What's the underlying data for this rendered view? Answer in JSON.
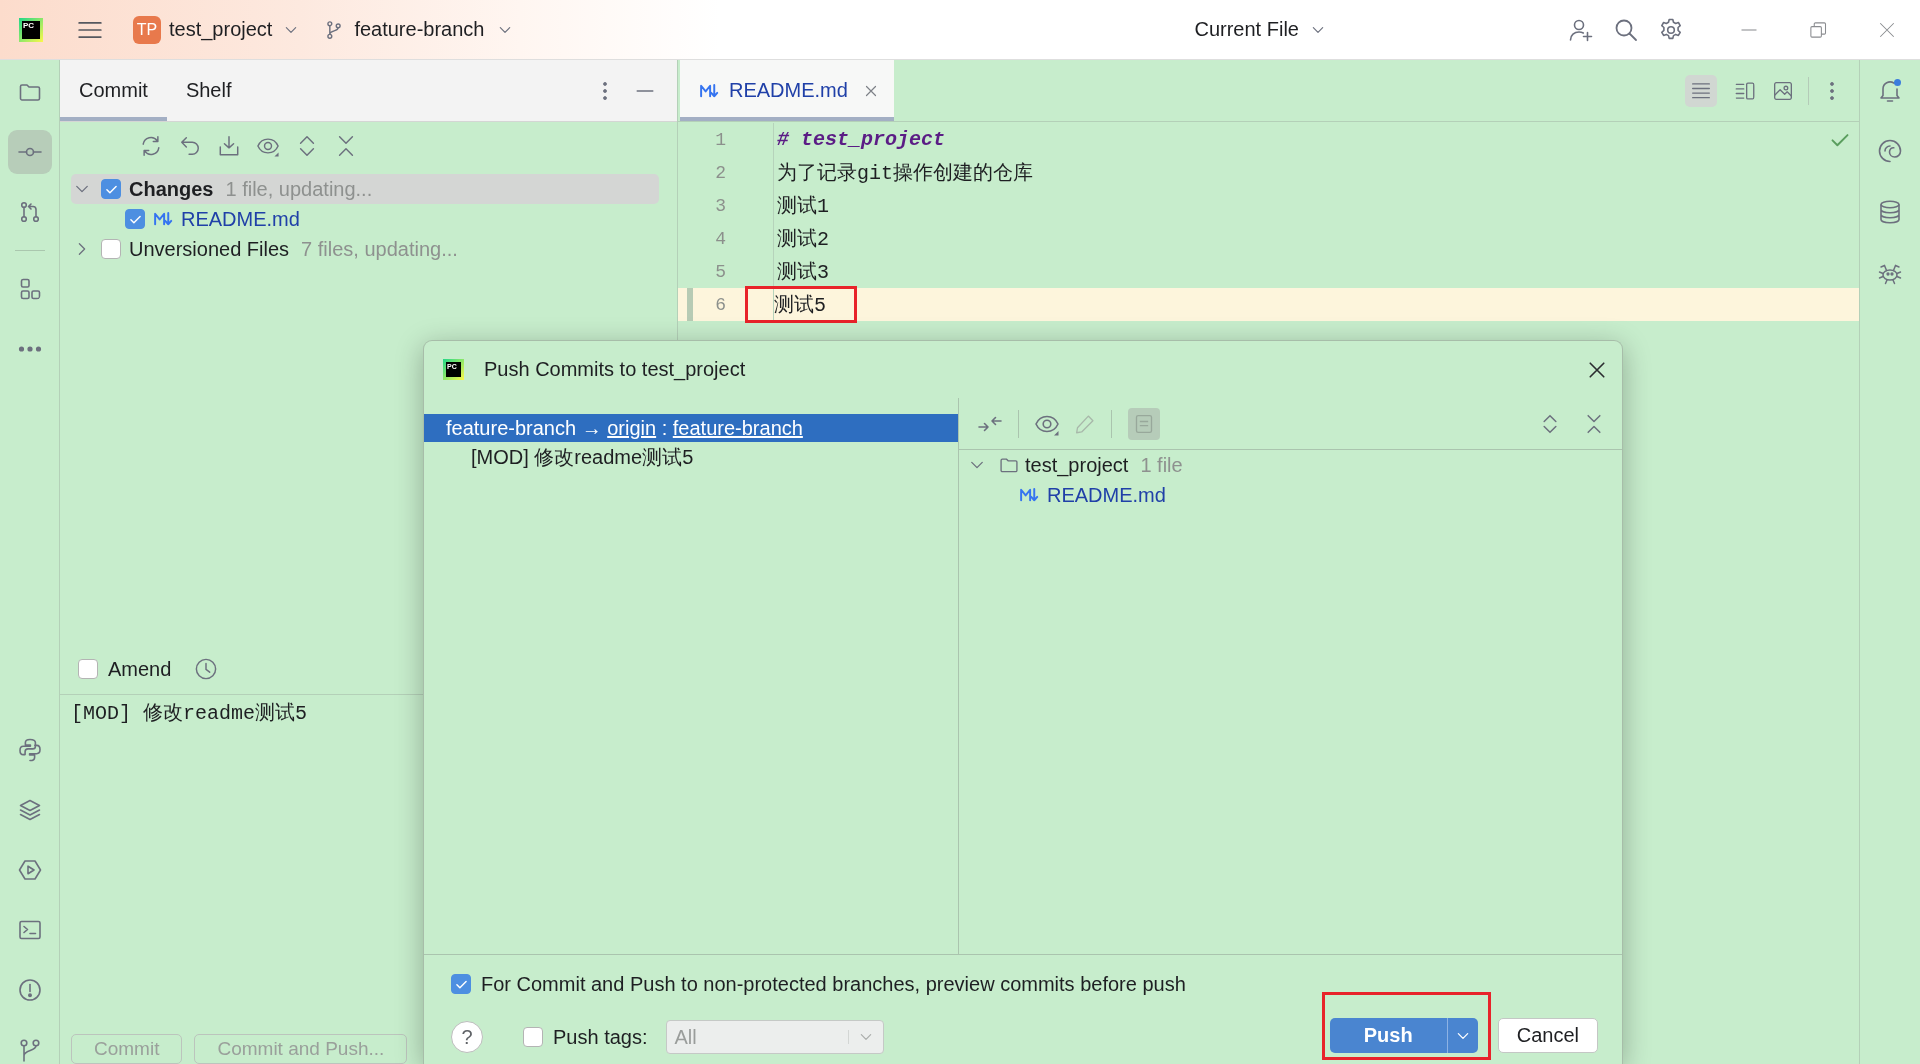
{
  "title_bar": {
    "logo": "PC",
    "project_badge": "TP",
    "project": "test_project",
    "branch": "feature-branch",
    "run_config": "Current File"
  },
  "tool_strip": {
    "top": [
      {
        "selected": false
      },
      {
        "selected": true
      },
      {
        "selected": false
      },
      {
        "selected": false
      },
      {
        "selected": false
      }
    ]
  },
  "commit_panel": {
    "tabs": [
      {
        "label": "Commit",
        "selected": true
      },
      {
        "label": "Shelf",
        "selected": false
      }
    ],
    "tree": [
      {
        "label": "Changes",
        "note": "1 file, updating...",
        "checked": true,
        "expanded": true,
        "selected": true,
        "children": [
          {
            "label": "README.md",
            "checked": true
          }
        ]
      },
      {
        "label": "Unversioned Files",
        "note": "7 files, updating...",
        "checked": false,
        "expanded": false,
        "selected": false
      }
    ],
    "amend": {
      "label": "Amend",
      "checked": false
    },
    "message": "[MOD] 修改readme测试5",
    "buttons": [
      {
        "label": "Commit",
        "disabled": true
      },
      {
        "label": "Commit and Push...",
        "disabled": true
      }
    ]
  },
  "editor": {
    "tabs": [
      {
        "label": "README.md",
        "selected": true
      }
    ],
    "view_modes": [
      {
        "selected": true
      },
      {
        "selected": false
      },
      {
        "selected": false
      }
    ],
    "lines": [
      {
        "number": "1",
        "text": "# test_project",
        "kind": "heading",
        "current": false,
        "modified": false,
        "boxed": false
      },
      {
        "number": "2",
        "text": "为了记录git操作创建的仓库",
        "kind": "text",
        "current": false,
        "modified": false,
        "boxed": false
      },
      {
        "number": "3",
        "text": "测试1",
        "kind": "text",
        "current": false,
        "modified": false,
        "boxed": false
      },
      {
        "number": "4",
        "text": "测试2",
        "kind": "text",
        "current": false,
        "modified": false,
        "boxed": false
      },
      {
        "number": "5",
        "text": "测试3",
        "kind": "text",
        "current": false,
        "modified": false,
        "boxed": false
      },
      {
        "number": "6",
        "text": "测试5",
        "kind": "text",
        "current": true,
        "modified": true,
        "boxed": true
      }
    ]
  },
  "dialog": {
    "logo": "PC",
    "title": "Push Commits to test_project",
    "push_target": {
      "source": "feature-branch",
      "arrow": "→",
      "remote": "origin",
      "separator": ":",
      "target": "feature-branch",
      "selected": true
    },
    "commits": [
      {
        "text": "[MOD] 修改readme测试5",
        "selected": false
      }
    ],
    "files": [
      {
        "label": "test_project",
        "note": "1 file",
        "expanded": true,
        "children": [
          {
            "label": "README.md"
          }
        ]
      }
    ],
    "preview_option": {
      "label": "For Commit and Push to non-protected branches, preview commits before push",
      "checked": true
    },
    "help": "?",
    "push_tags": {
      "label": "Push tags:",
      "checked": false,
      "value": "All",
      "disabled": true
    },
    "buttons": [
      {
        "label": "Push",
        "kind": "primary",
        "boxed": true
      },
      {
        "label": "Cancel",
        "kind": "secondary",
        "boxed": false
      }
    ]
  }
}
